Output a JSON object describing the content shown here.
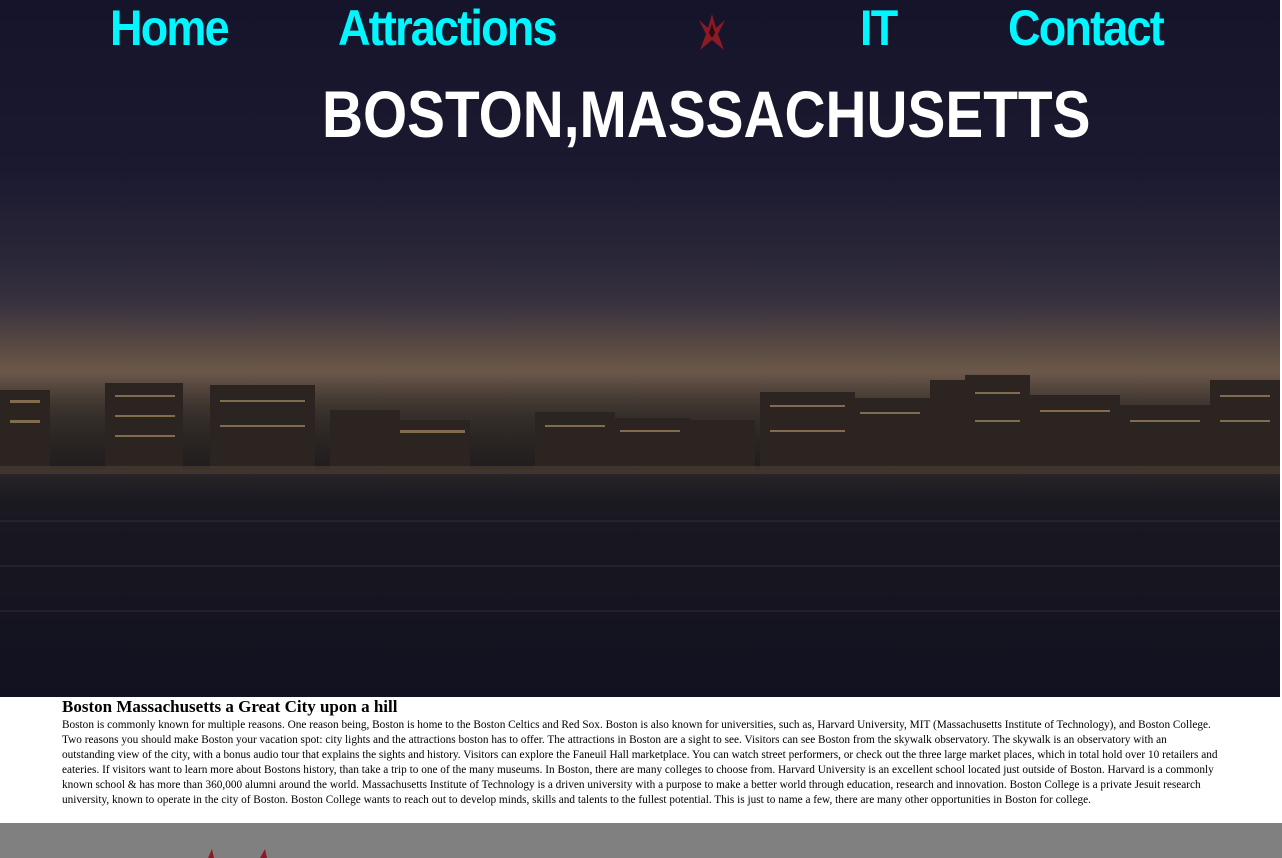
{
  "nav": {
    "items": [
      {
        "label": "Home"
      },
      {
        "label": "Attractions"
      },
      {
        "label": "IT"
      },
      {
        "label": "Contact"
      }
    ],
    "logo_icon": "red-star-logo-icon"
  },
  "hero": {
    "title": "BOSTON,MASSACHUSETTS",
    "image": "night-city-skyline-over-water"
  },
  "article": {
    "heading": "Boston Massachusetts a Great City upon a hill",
    "body": "Boston is commonly known for multiple reasons. One reason being, Boston is home to the Boston Celtics and Red Sox. Boston is also known for universities, such as, Harvard University, MIT (Massachusetts Institute of Technology), and Boston College. Two reasons you should make Boston your vacation spot: city lights and the attractions boston has to offer. The attractions in Boston are a sight to see. Visitors can see Boston from the skywalk observatory. The skywalk is an observatory with an outstanding view of the city, with a bonus audio tour that explains the sights and history. Visitors can explore the Faneuil Hall marketplace. You can watch street performers, or check out the three large market places, which in total hold over 10 retailers and eateries. If visitors want to learn more about Bostons history, than take a trip to one of the many museums. In Boston, there are many colleges to choose from. Harvard University is an excellent school located just outside of Boston. Harvard is a commonly known school & has more than 360,000 alumni around the world. Massachusetts Institute of Technology is a driven university with a purpose to make a better world through education, research and innovation. Boston College is a private Jesuit research university, known to operate in the city of Boston. Boston College wants to reach out to develop minds, skills and talents to the fullest potential. This is just to name a few, there are many other opportunities in Boston for college."
  },
  "colors": {
    "nav_link": "#00f7ff",
    "title": "#ffffff",
    "footer": "#808080",
    "logo": "#8b1a24"
  }
}
